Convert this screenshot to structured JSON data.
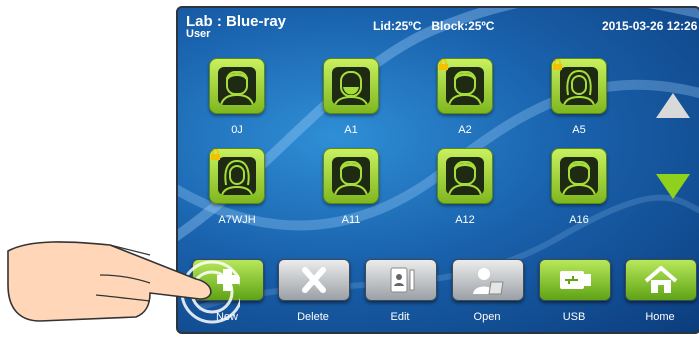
{
  "header": {
    "lab": "Lab : Blue-ray",
    "user_label": "User",
    "temperatures": "Lid:25ºC   Block:25ºC",
    "datetime": "2015-03-26 12:26"
  },
  "users": [
    {
      "name": "0J",
      "avatar": "male-user-icon",
      "locked": false
    },
    {
      "name": "A1",
      "avatar": "bearded-user-icon",
      "locked": false
    },
    {
      "name": "A2",
      "avatar": "male-user-icon",
      "locked": true
    },
    {
      "name": "A5",
      "avatar": "female-user-icon",
      "locked": true
    },
    {
      "name": "A7WJH",
      "avatar": "female-user-icon",
      "locked": true
    },
    {
      "name": "A11",
      "avatar": "male-user-icon",
      "locked": false
    },
    {
      "name": "A12",
      "avatar": "male-user-icon",
      "locked": false
    },
    {
      "name": "A16",
      "avatar": "male-user-icon",
      "locked": false
    }
  ],
  "toolbar": {
    "new_label": "New",
    "delete_label": "Delete",
    "edit_label": "Edit",
    "open_label": "Open",
    "usb_label": "USB",
    "home_label": "Home"
  },
  "colors": {
    "accent_green": "#8fd11c",
    "screen_blue": "#1a62ad",
    "button_gray": "#d9d9d9"
  }
}
